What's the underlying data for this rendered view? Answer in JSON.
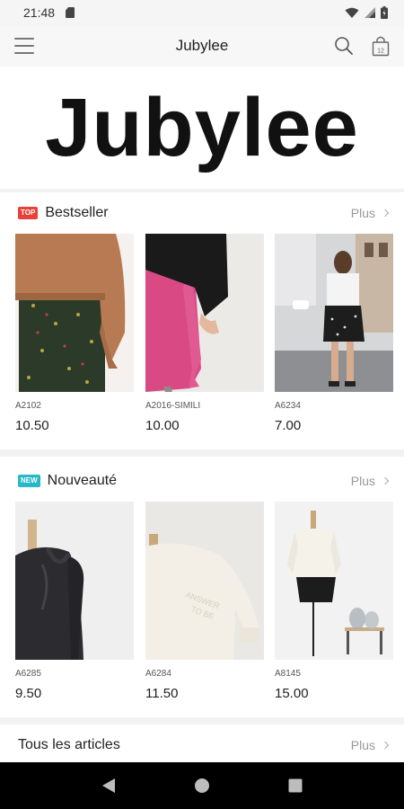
{
  "status": {
    "time": "21:48"
  },
  "app_bar": {
    "title": "Jubylee"
  },
  "banner": {
    "logo_text": "Jubylee"
  },
  "sections": [
    {
      "badge": "TOP",
      "title": "Bestseller",
      "more": "Plus",
      "products": [
        {
          "code": "A2102",
          "price": "10.50"
        },
        {
          "code": "A2016-SIMILI",
          "price": "10.00"
        },
        {
          "code": "A6234",
          "price": "7.00"
        }
      ]
    },
    {
      "badge": "NEW",
      "title": "Nouveauté",
      "more": "Plus",
      "products": [
        {
          "code": "A6285",
          "price": "9.50"
        },
        {
          "code": "A6284",
          "price": "11.50"
        },
        {
          "code": "A8145",
          "price": "15.00"
        }
      ]
    },
    {
      "title": "Tous les articles",
      "more": "Plus"
    }
  ],
  "colors": {
    "badge_top": "#e8413a",
    "badge_new": "#28b9c8",
    "nav_bar": "#000000"
  }
}
